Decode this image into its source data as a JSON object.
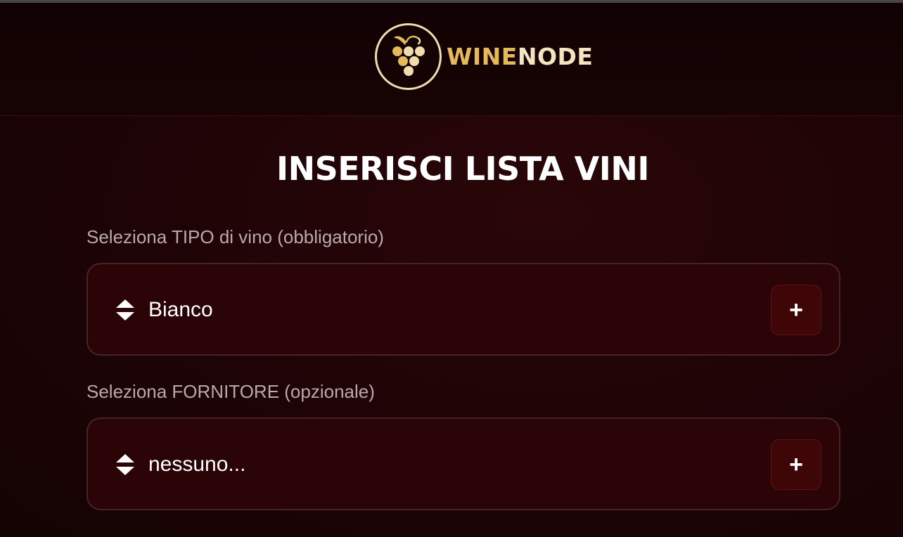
{
  "brand": {
    "name_part1": "WINE",
    "name_part2": "NODE",
    "logo_icon": "grape-vine-icon",
    "gold": "#e3b95a",
    "cream": "#f4e4c0"
  },
  "page": {
    "title": "INSERISCI LISTA VINI"
  },
  "form": {
    "wine_type": {
      "label": "Seleziona TIPO di vino (obbligatorio)",
      "value": "Bianco",
      "add_label": "+"
    },
    "supplier": {
      "label": "Seleziona FORNITORE (opzionale)",
      "value": "nessuno...",
      "add_label": "+"
    }
  },
  "colors": {
    "background": "#1d0406",
    "field_background": "#2a0406",
    "accent_button": "#3f0608"
  }
}
